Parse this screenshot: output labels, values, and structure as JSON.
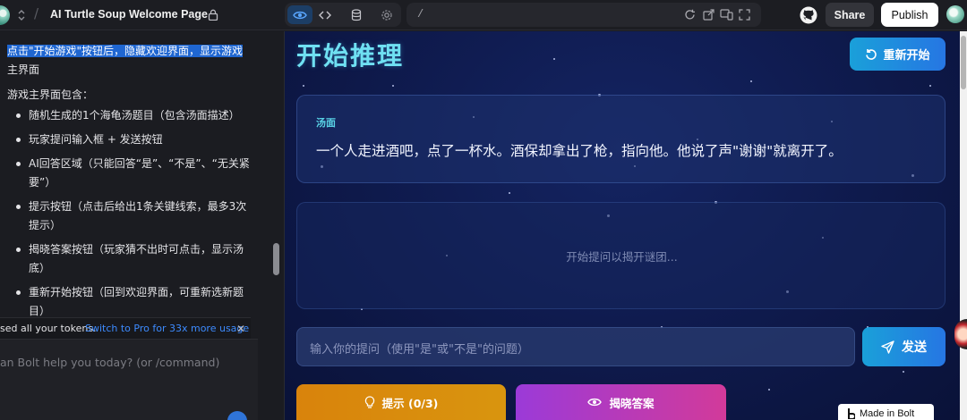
{
  "app": {
    "project_title": "AI Turtle Soup Welcome Page",
    "url_path": "/",
    "share_label": "Share",
    "publish_label": "Publish"
  },
  "chat": {
    "instruction": "点击\"开始游戏\"按钮后，隐藏欢迎界面，显示游戏主界面",
    "instruction_highlighted": "点击\"开始游戏\"按钮后，隐藏欢迎界面，显示游戏",
    "instruction_rest": "主界面",
    "subhead": "游戏主界面包含：",
    "items": [
      {
        "label": "随机生成的1个海龟汤题目（包含汤面描述）"
      },
      {
        "label": "玩家提问输入框 + 发送按钮"
      },
      {
        "label": "AI回答区域（只能回答“是”、“不是”、“无关紧要”）"
      },
      {
        "label": "提示按钮（点击后给出1条关键线索，最多3次提示）"
      },
      {
        "label": "揭晓答案按钮（玩家猜不出时可点击，显示汤底）"
      },
      {
        "label": "重新开始按钮（回到欢迎界面，可重新选新题目）"
      }
    ],
    "token_notice": "sed all your tokens.",
    "token_link": "Switch to Pro for 33x more usage",
    "close_glyph": "✕",
    "input_placeholder": "an Bolt help you today? (or /command)"
  },
  "preview": {
    "title": "开始推理",
    "restart_label": "重新开始",
    "soup_label": "汤面",
    "soup_text": "一个人走进酒吧，点了一杯水。酒保却拿出了枪，指向他。他说了声\"谢谢\"就离开了。",
    "qa_empty": "开始提问以揭开谜团...",
    "question_placeholder": "输入你的提问（使用\"是\"或\"不是\"的问题）",
    "send_label": "发送",
    "hint_label": "提示 (0/3)",
    "reveal_label": "揭晓答案",
    "made_in_bolt": "Made in Bolt"
  },
  "colors": {
    "accent": "#2676e3",
    "title_cyan": "#6fe0f2",
    "hint_orange": "#d9830c",
    "reveal_purple": "#9b3ad8"
  },
  "icons": [
    "logo-icon",
    "chevron-updown-icon",
    "lock-icon",
    "eye-icon",
    "code-icon",
    "database-icon",
    "settings-icon",
    "refresh-icon",
    "external-icon",
    "devices-icon",
    "fullscreen-icon",
    "github-icon",
    "restart-icon",
    "send-icon",
    "lightbulb-icon",
    "eye-icon"
  ]
}
